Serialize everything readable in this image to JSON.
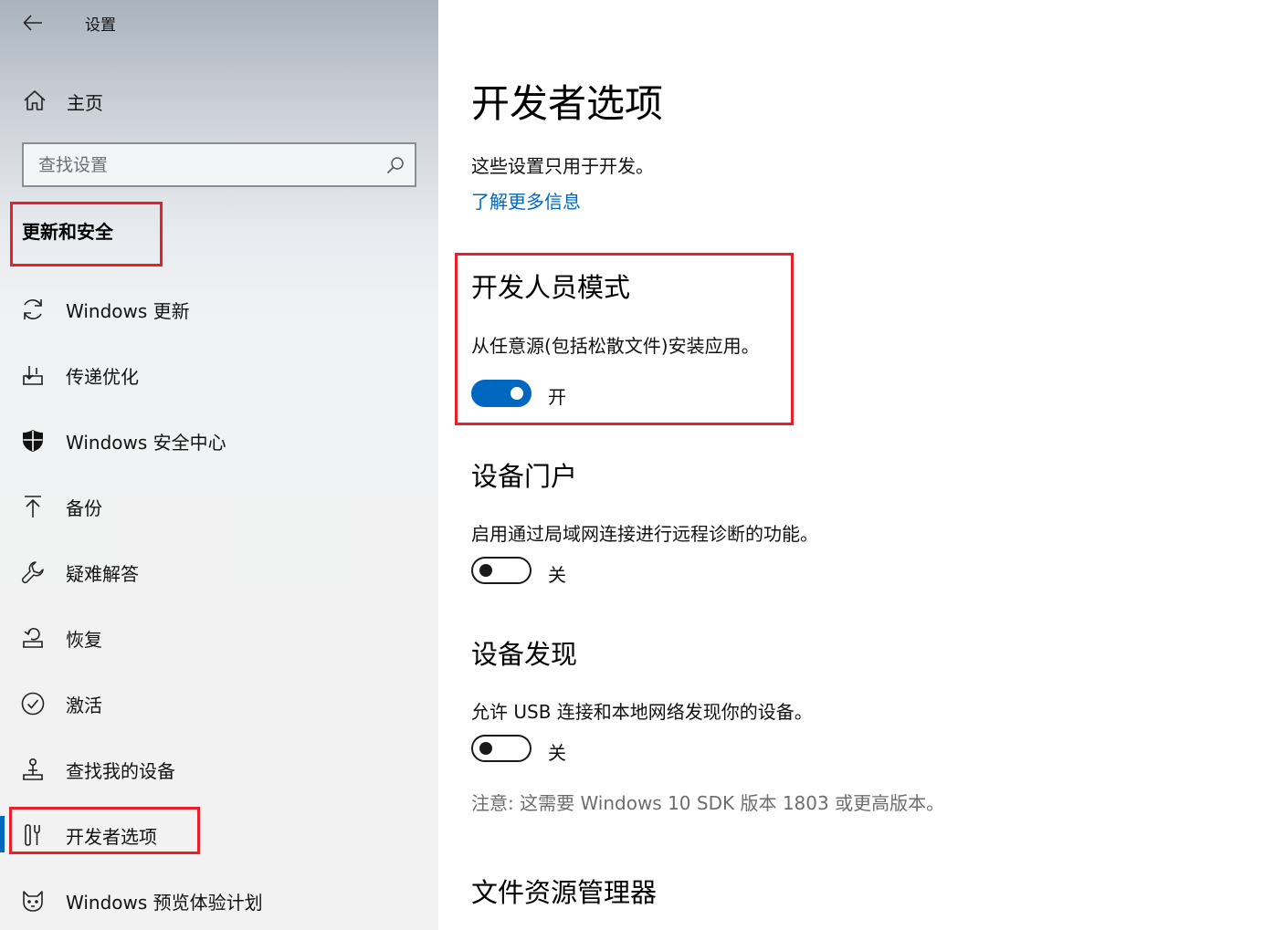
{
  "app": {
    "title": "设置"
  },
  "sidebar": {
    "home_label": "主页",
    "search_placeholder": "查找设置",
    "section_heading": "更新和安全",
    "items": [
      {
        "label": "Windows 更新",
        "icon": "sync-icon"
      },
      {
        "label": "传递优化",
        "icon": "delivery-optimization-icon"
      },
      {
        "label": "Windows 安全中心",
        "icon": "shield-icon"
      },
      {
        "label": "备份",
        "icon": "backup-arrow-icon"
      },
      {
        "label": "疑难解答",
        "icon": "wrench-icon"
      },
      {
        "label": "恢复",
        "icon": "recovery-icon"
      },
      {
        "label": "激活",
        "icon": "check-circle-icon"
      },
      {
        "label": "查找我的设备",
        "icon": "find-device-icon"
      },
      {
        "label": "开发者选项",
        "icon": "developer-tools-icon",
        "active": true
      },
      {
        "label": "Windows 预览体验计划",
        "icon": "insider-cat-icon"
      }
    ]
  },
  "main": {
    "title": "开发者选项",
    "description": "这些设置只用于开发。",
    "learn_more": "了解更多信息",
    "developer_mode": {
      "title": "开发人员模式",
      "description": "从任意源(包括松散文件)安装应用。",
      "state_label": "开",
      "on": true
    },
    "device_portal": {
      "title": "设备门户",
      "description": "启用通过局域网连接进行远程诊断的功能。",
      "state_label": "关",
      "on": false
    },
    "device_discovery": {
      "title": "设备发现",
      "description": "允许 USB 连接和本地网络发现你的设备。",
      "state_label": "关",
      "on": false,
      "note": "注意: 这需要 Windows 10 SDK 版本 1803 或更高版本。"
    },
    "file_explorer": {
      "title": "文件资源管理器"
    }
  },
  "colors": {
    "accent": "#0067c0",
    "highlight": "#e8202a"
  }
}
